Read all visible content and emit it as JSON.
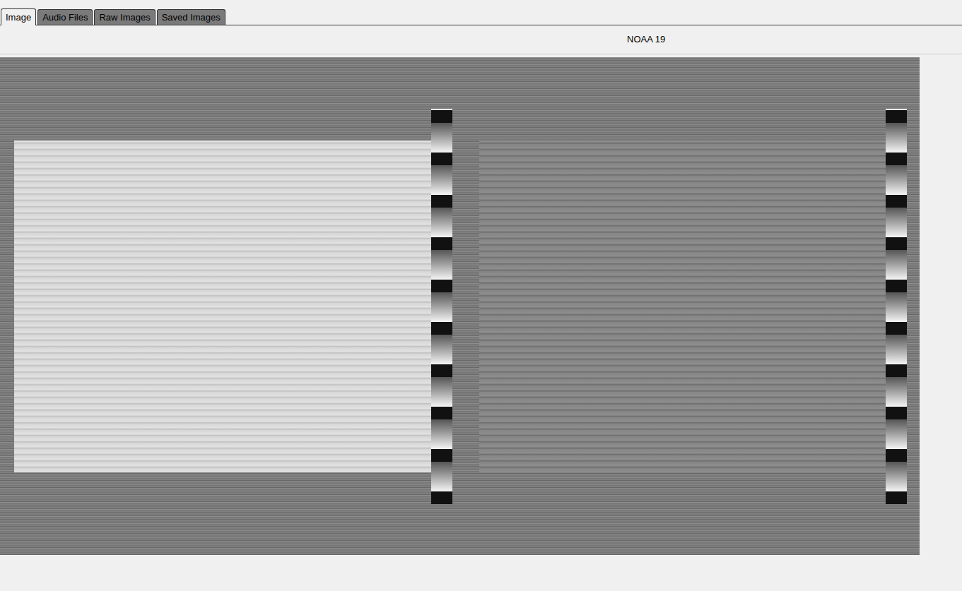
{
  "tabs": [
    {
      "label": "Image",
      "selected": true
    },
    {
      "label": "Audio Files",
      "selected": false
    },
    {
      "label": "Raw Images",
      "selected": false
    },
    {
      "label": "Saved Images",
      "selected": false
    }
  ],
  "header": {
    "title": "NOAA 19"
  }
}
